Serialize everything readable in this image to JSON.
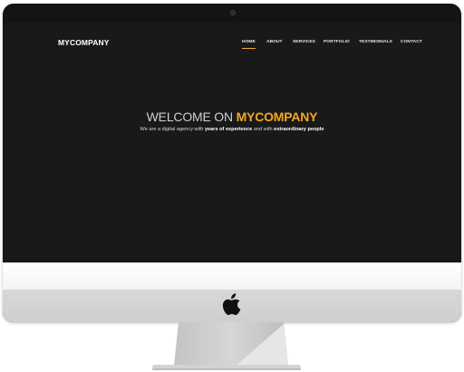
{
  "site": {
    "brand": "MYCOMPANY",
    "nav": [
      {
        "label": "HOME",
        "active": true
      },
      {
        "label": "ABOUT",
        "active": false
      },
      {
        "label": "SERVICES",
        "active": false
      },
      {
        "label": "PORTFOLIO",
        "active": false
      },
      {
        "label": "TESTIMONIALS",
        "active": false
      },
      {
        "label": "CONTACT",
        "active": false
      }
    ],
    "hero": {
      "title_prefix": "WELCOME ON ",
      "title_highlight": "MYCOMPANY",
      "subtitle_part1": "We are a digital agency with ",
      "subtitle_bold1": "years of experience",
      "subtitle_part2": " and with ",
      "subtitle_bold2": "extraordinary people"
    }
  },
  "colors": {
    "accent": "#f5a623",
    "screen_background": "#191919",
    "text": "#ffffff"
  },
  "icons": {
    "device_logo": "apple-logo-icon",
    "camera": "webcam-icon"
  }
}
